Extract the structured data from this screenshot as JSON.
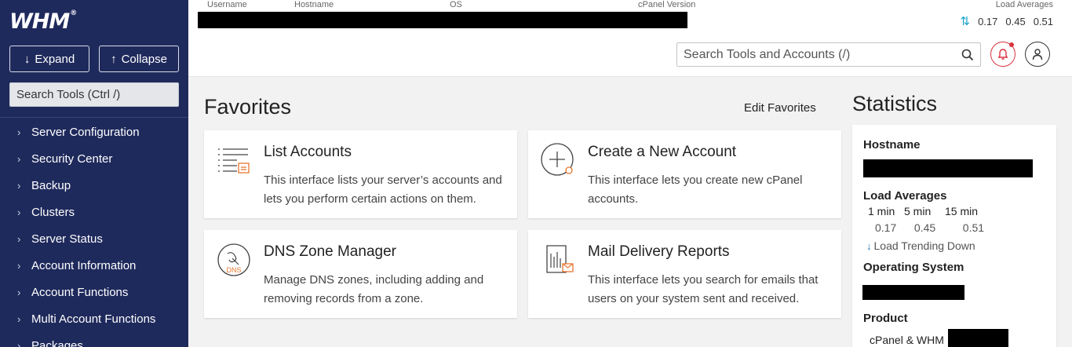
{
  "sidebar": {
    "logo": "WHM",
    "logo_mark": "®",
    "expand_label": "Expand",
    "collapse_label": "Collapse",
    "search_placeholder": "Search Tools (Ctrl /)",
    "items": [
      {
        "label": "Server Configuration"
      },
      {
        "label": "Security Center"
      },
      {
        "label": "Backup"
      },
      {
        "label": "Clusters"
      },
      {
        "label": "Server Status"
      },
      {
        "label": "Account Information"
      },
      {
        "label": "Account Functions"
      },
      {
        "label": "Multi Account Functions"
      },
      {
        "label": "Packages"
      }
    ]
  },
  "header": {
    "labels": {
      "username": "Username",
      "hostname": "Hostname",
      "os": "OS",
      "cpanel_version": "cPanel Version"
    },
    "load_title": "Load Averages",
    "load_values": [
      "0.17",
      "0.45",
      "0.51"
    ],
    "search_placeholder": "Search Tools and Accounts (/)"
  },
  "favorites": {
    "title": "Favorites",
    "edit_label": "Edit Favorites",
    "cards": [
      {
        "title": "List Accounts",
        "desc": "This interface lists your server’s accounts and lets you perform certain actions on them.",
        "icon": "list-accounts-icon"
      },
      {
        "title": "Create a New Account",
        "desc": "This interface lets you create new cPanel accounts.",
        "icon": "create-account-icon"
      },
      {
        "title": "DNS Zone Manager",
        "desc": "Manage DNS zones, including adding and removing records from a zone.",
        "icon": "dns-zone-icon",
        "icon_text": "DNS"
      },
      {
        "title": "Mail Delivery Reports",
        "desc": "This interface lets you search for emails that users on your system sent and received.",
        "icon": "mail-report-icon"
      }
    ]
  },
  "stats": {
    "title": "Statistics",
    "hostname_label": "Hostname",
    "load_label": "Load Averages",
    "load_cols": [
      "1 min",
      "5 min",
      "15 min"
    ],
    "load_vals": [
      "0.17",
      "0.45",
      "0.51"
    ],
    "trend": "Load Trending Down",
    "os_label": "Operating System",
    "product_label": "Product",
    "product_value": "cPanel & WHM"
  },
  "colors": {
    "sidebar_bg": "#1f2a5c",
    "accent_orange": "#e8772e",
    "alert_red": "#d9333f",
    "trend_blue": "#1a73b8"
  }
}
